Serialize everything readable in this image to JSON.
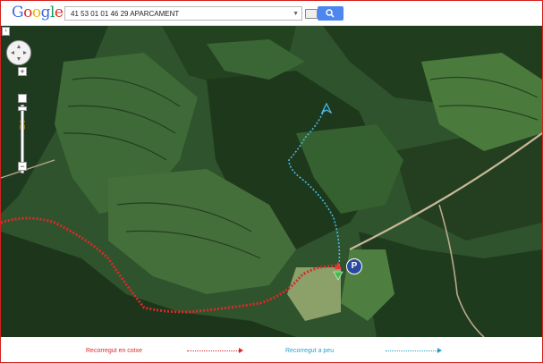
{
  "logo": {
    "letters": [
      "G",
      "o",
      "o",
      "g",
      "l",
      "e"
    ],
    "colors": [
      "#3b6be0",
      "#d93025",
      "#f4b400",
      "#3b6be0",
      "#0f9d58",
      "#d93025"
    ]
  },
  "search": {
    "value": "41 53 01 01 46 29   APARCAMENT"
  },
  "controls": {
    "zoom_in": "+",
    "zoom_out": "−"
  },
  "map": {
    "parking_label": "P",
    "route_car_color": "#d92a2a",
    "route_walk_color": "#2a9fcc"
  },
  "legend": {
    "car_label": "Recorregut en cotxe",
    "walk_label": "Recorregut a peu"
  }
}
